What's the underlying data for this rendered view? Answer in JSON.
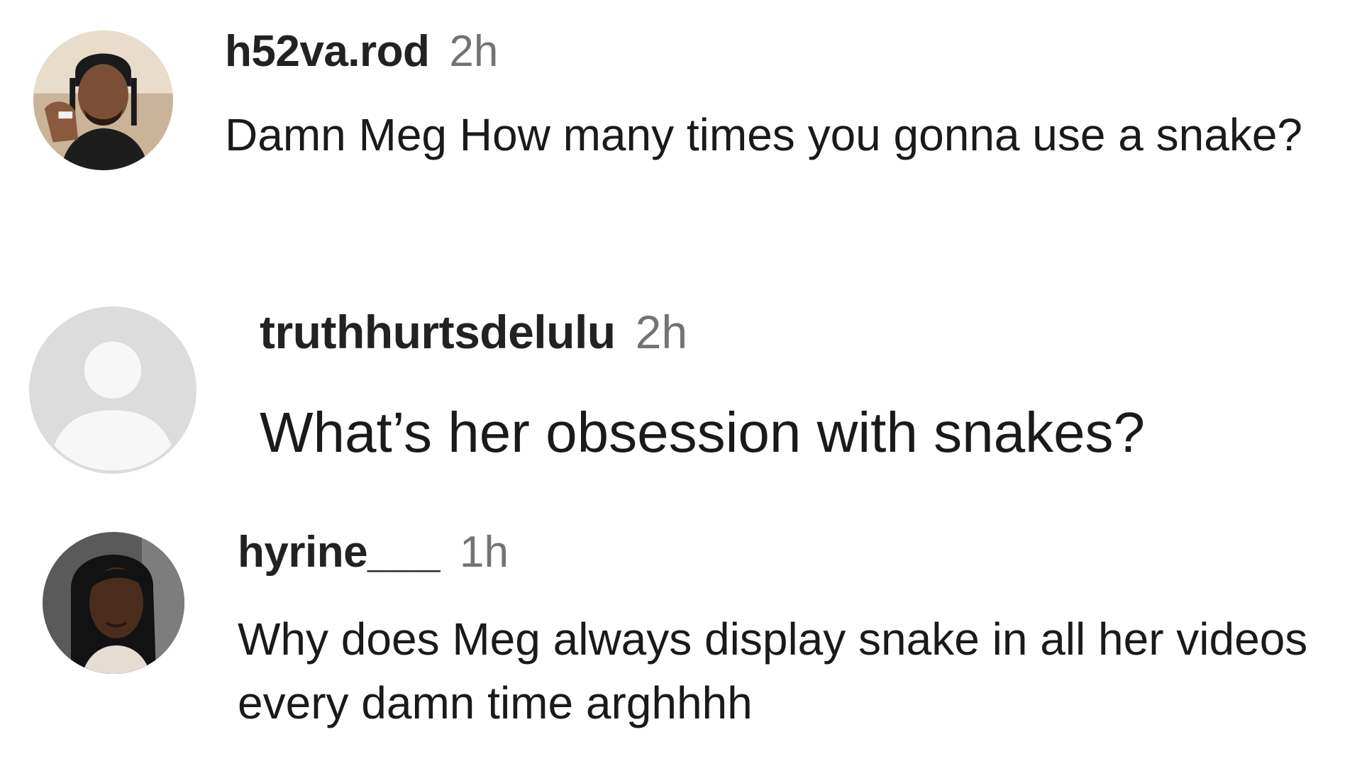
{
  "comments": [
    {
      "username": "h52va.rod",
      "time": "2h",
      "text": "Damn Meg How many times you gonna use a snake?",
      "avatar": "profile-photo-man"
    },
    {
      "username": "truthhurtsdelulu",
      "time": "2h",
      "text": "What’s her obsession with snakes?",
      "avatar": "default-user-icon"
    },
    {
      "username": "hyrine___",
      "time": "1h",
      "text": "Why does Meg always display snake in all her videos every damn time arghhhh",
      "avatar": "profile-photo-woman"
    }
  ],
  "colors": {
    "username": "#222222",
    "timestamp": "#737373",
    "comment_text": "#1a1a1a",
    "default_avatar_bg": "#dcdcdc",
    "default_avatar_fg": "#f7f7f7"
  }
}
